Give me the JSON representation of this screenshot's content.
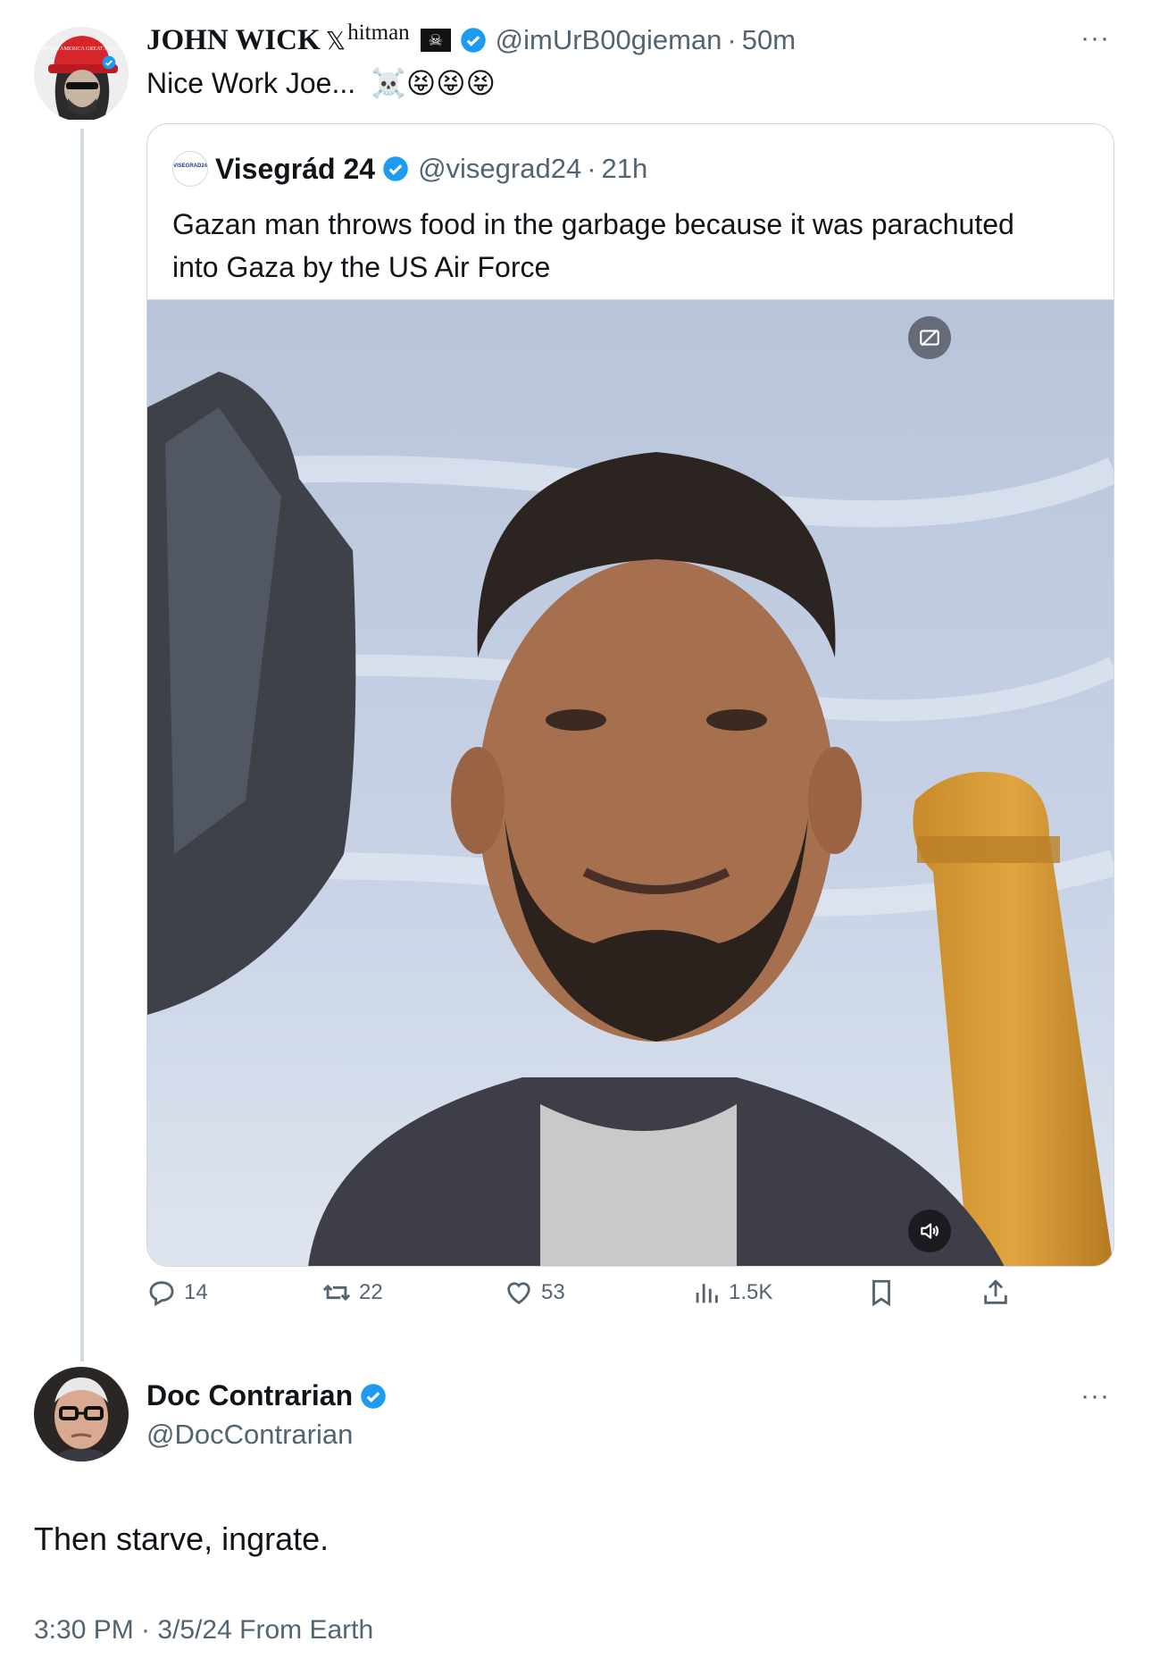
{
  "parent_tweet": {
    "display_name": "JOHN WICK",
    "name_suffix": "hitman",
    "handle": "@imUrB00gieman",
    "separator": "·",
    "time": "50m",
    "text": "Nice Work Joe...",
    "emoji": "☠️😝😝😝",
    "more_label": "···",
    "cap_text": "MAKE AMERICA GREAT AGAIN"
  },
  "quoted_tweet": {
    "display_name": "Visegrád 24",
    "handle": "@visegrad24",
    "separator": "·",
    "time": "21h",
    "text_line1": "Gazan man throws food in the garbage because it was parachuted",
    "text_line2": "into Gaza by the US Air Force",
    "avatar_text": "VISEGRAD24"
  },
  "actions": {
    "replies": "14",
    "retweets": "22",
    "likes": "53",
    "views": "1.5K"
  },
  "reply_tweet": {
    "display_name": "Doc Contrarian",
    "handle": "@DocContrarian",
    "text": "Then starve, ingrate.",
    "timestamp": "3:30 PM · 3/5/24 From Earth",
    "more_label": "···"
  },
  "colors": {
    "verified": "#1d9bf0",
    "muted": "#536471",
    "border": "#cfd9de"
  }
}
